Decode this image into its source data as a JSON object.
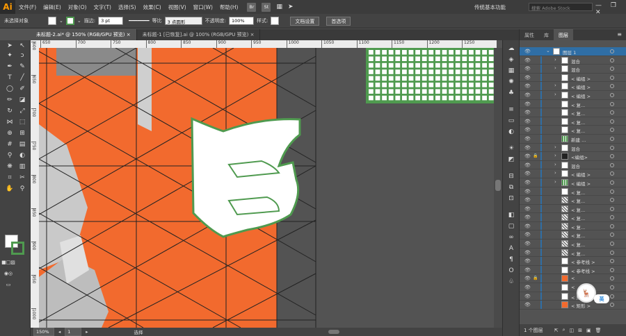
{
  "app": {
    "logo": "Ai",
    "menus": [
      "文件(F)",
      "编辑(E)",
      "对象(O)",
      "文字(T)",
      "选择(S)",
      "效果(C)",
      "视图(V)",
      "窗口(W)",
      "帮助(H)"
    ],
    "bridge": "Br",
    "stock": "St",
    "workspace": "传统基本功能",
    "search_placeholder": "搜索 Adobe Stock",
    "win": "— ❐ ✕"
  },
  "control": {
    "no_selection": "未选择对象",
    "stroke_label": "描边:",
    "stroke_value": "3 pt",
    "uniform": "等比",
    "brush": "3 点圆形",
    "opacity_label": "不透明度:",
    "opacity_value": "100%",
    "style_label": "样式:",
    "doc_setup": "文档设置",
    "prefs": "首选项"
  },
  "tabs": [
    {
      "label": "未标题-2.ai* @ 150% (RGB/GPU 预览)",
      "close": "×"
    },
    {
      "label": "未标题-1 [已恢复].ai @ 100% (RGB/GPU 预览)",
      "close": "×"
    }
  ],
  "ruler": {
    "h": [
      "650",
      "700",
      "750",
      "800",
      "850",
      "900",
      "950",
      "1000",
      "1050",
      "1100",
      "1150",
      "1200",
      "1250",
      "1300",
      "1350",
      "1400",
      "1450"
    ],
    "v": [
      "600",
      "650",
      "700",
      "750",
      "800",
      "850",
      "900",
      "950",
      "1000"
    ]
  },
  "status": {
    "zoom": "150%",
    "page": "1",
    "tool": "选择"
  },
  "panel": {
    "tabs": [
      "属性",
      "库",
      "图层"
    ],
    "menu": "≡",
    "footer": "1 个图层"
  },
  "layers": [
    {
      "label": "图层 1",
      "lv": 0,
      "arrow": "⌄",
      "sel": true,
      "thumb": "white"
    },
    {
      "label": "混合",
      "lv": 1,
      "arrow": "›",
      "thumb": "white"
    },
    {
      "label": "混合",
      "lv": 1,
      "arrow": "›",
      "thumb": "white"
    },
    {
      "label": "< 编组 >",
      "lv": 1,
      "arrow": "",
      "thumb": "white"
    },
    {
      "label": "< 编组 >",
      "lv": 1,
      "arrow": "›",
      "thumb": "white"
    },
    {
      "label": "< 编组 >",
      "lv": 1,
      "arrow": "›",
      "thumb": "white"
    },
    {
      "label": "< 复...",
      "lv": 1,
      "arrow": "",
      "thumb": "white"
    },
    {
      "label": "< 复...",
      "lv": 1,
      "arrow": "",
      "thumb": "white"
    },
    {
      "label": "< 复...",
      "lv": 1,
      "arrow": "",
      "thumb": "white"
    },
    {
      "label": "< 复...",
      "lv": 1,
      "arrow": "",
      "thumb": "white"
    },
    {
      "label": "新建 ...",
      "lv": 1,
      "arrow": "",
      "thumb": "grid"
    },
    {
      "label": "混合",
      "lv": 1,
      "arrow": "›",
      "thumb": "white"
    },
    {
      "label": "<编组>",
      "lv": 1,
      "arrow": "›",
      "thumb": "dark",
      "lock": true
    },
    {
      "label": "混合",
      "lv": 1,
      "arrow": "›",
      "thumb": "white"
    },
    {
      "label": "< 编组 >",
      "lv": 1,
      "arrow": "›",
      "thumb": "white"
    },
    {
      "label": "< 编组 >",
      "lv": 1,
      "arrow": "›",
      "thumb": "grid"
    },
    {
      "label": "< 复...",
      "lv": 1,
      "arrow": "",
      "thumb": "white"
    },
    {
      "label": "< 复...",
      "lv": 1,
      "arrow": "",
      "thumb": "stripe"
    },
    {
      "label": "< 复...",
      "lv": 1,
      "arrow": "",
      "thumb": "stripe"
    },
    {
      "label": "< 复...",
      "lv": 1,
      "arrow": "",
      "thumb": "stripe"
    },
    {
      "label": "< 复...",
      "lv": 1,
      "arrow": "",
      "thumb": "stripe"
    },
    {
      "label": "< 复...",
      "lv": 1,
      "arrow": "",
      "thumb": "stripe"
    },
    {
      "label": "< 复...",
      "lv": 1,
      "arrow": "",
      "thumb": "stripe"
    },
    {
      "label": "< 复...",
      "lv": 1,
      "arrow": "",
      "thumb": "stripe"
    },
    {
      "label": "< 参考线 >",
      "lv": 1,
      "arrow": "",
      "thumb": "white"
    },
    {
      "label": "< 参考线 >",
      "lv": 1,
      "arrow": "",
      "thumb": "white"
    },
    {
      "label": "<",
      "lv": 1,
      "arrow": "",
      "thumb": "orange",
      "lock": true
    },
    {
      "label": "<",
      "lv": 1,
      "arrow": "",
      "thumb": "white"
    },
    {
      "label": "< 矩形 >",
      "lv": 1,
      "arrow": "",
      "thumb": "white"
    },
    {
      "label": "< 矩形 >",
      "lv": 1,
      "arrow": "",
      "thumb": "orange"
    }
  ],
  "overlay": {
    "badge": "合木木",
    "ime": "英"
  },
  "colors": {
    "orange": "#f26a2e",
    "green": "#4f9a4f",
    "selection": "#2f6ea5"
  }
}
